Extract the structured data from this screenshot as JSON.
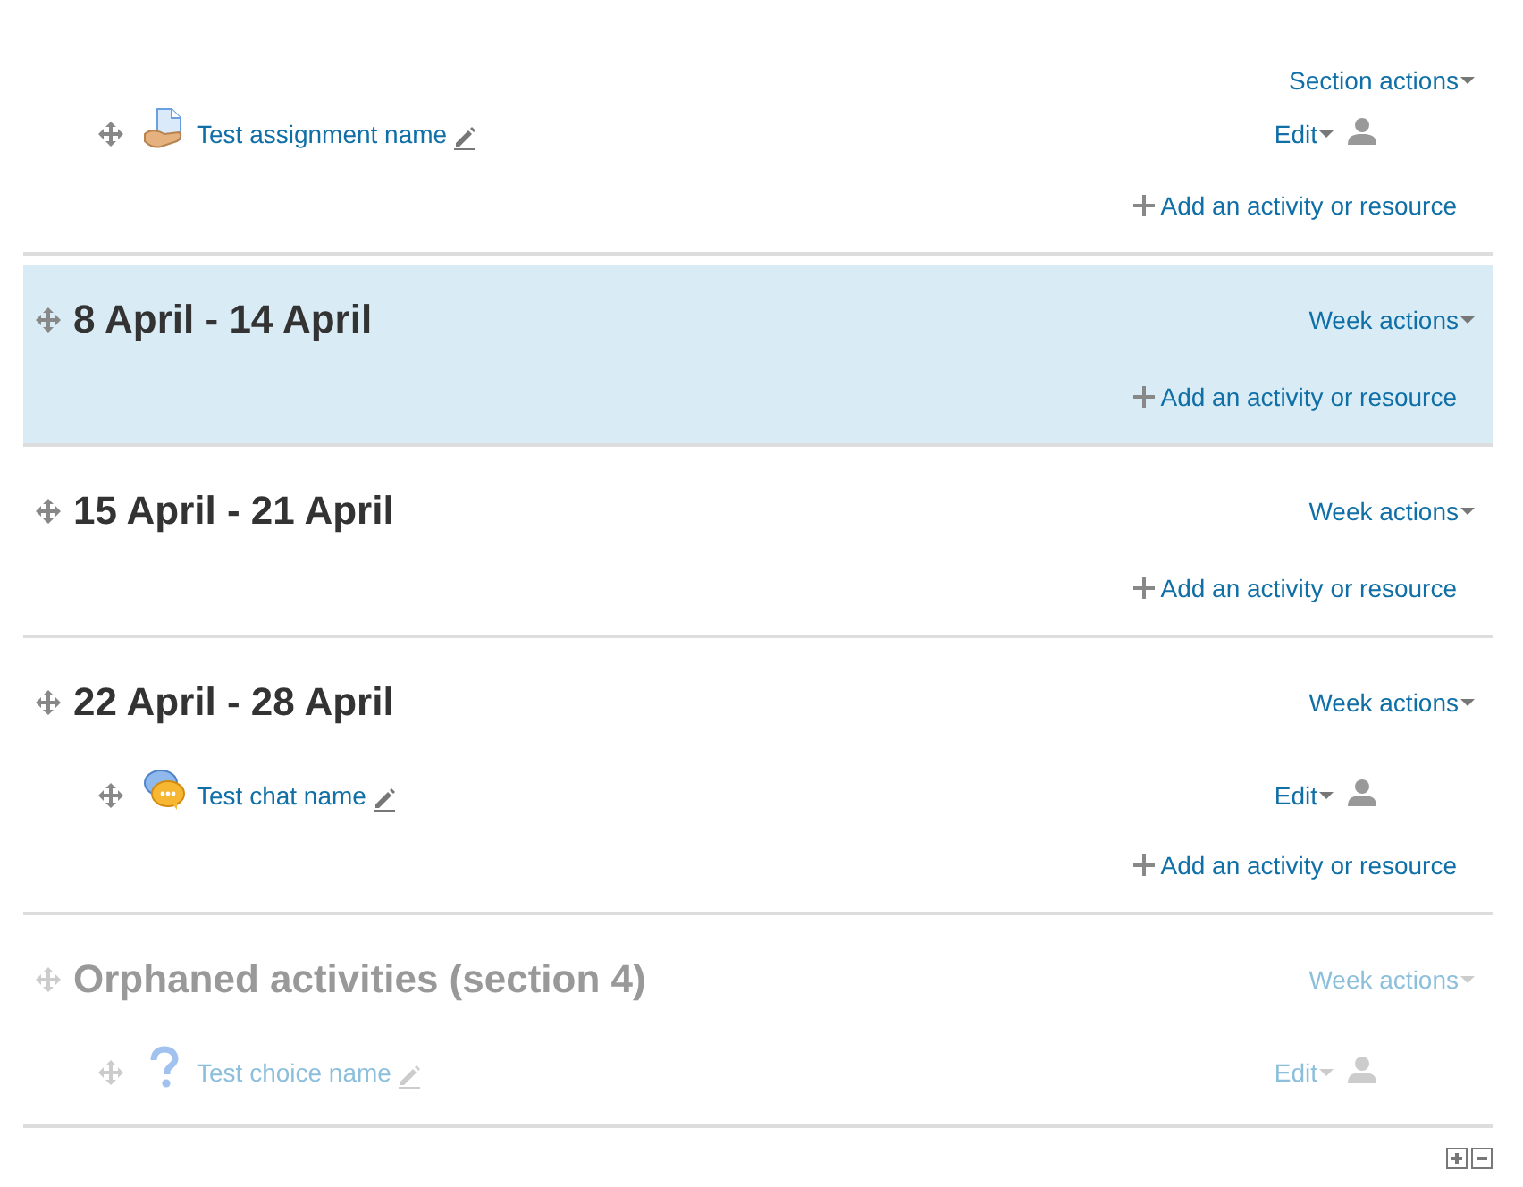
{
  "sections": [
    {
      "current": false,
      "hidden": false,
      "actions_label": "Section actions",
      "activities": [
        {
          "kind": "assign",
          "name": "Test assignment name",
          "edit_label": "Edit"
        }
      ],
      "add_link": "Add an activity or resource"
    },
    {
      "title": "8 April - 14 April",
      "current": true,
      "hidden": false,
      "actions_label": "Week actions",
      "add_link": "Add an activity or resource"
    },
    {
      "title": "15 April - 21 April",
      "current": false,
      "hidden": false,
      "actions_label": "Week actions",
      "add_link": "Add an activity or resource"
    },
    {
      "title": "22 April - 28 April",
      "current": false,
      "hidden": false,
      "actions_label": "Week actions",
      "activities": [
        {
          "kind": "chat",
          "name": "Test chat name",
          "edit_label": "Edit"
        }
      ],
      "add_link": "Add an activity or resource"
    },
    {
      "title": "Orphaned activities (section 4)",
      "current": false,
      "hidden": true,
      "actions_label": "Week actions",
      "activities": [
        {
          "kind": "choice",
          "name": "Test choice name",
          "edit_label": "Edit"
        }
      ]
    }
  ]
}
